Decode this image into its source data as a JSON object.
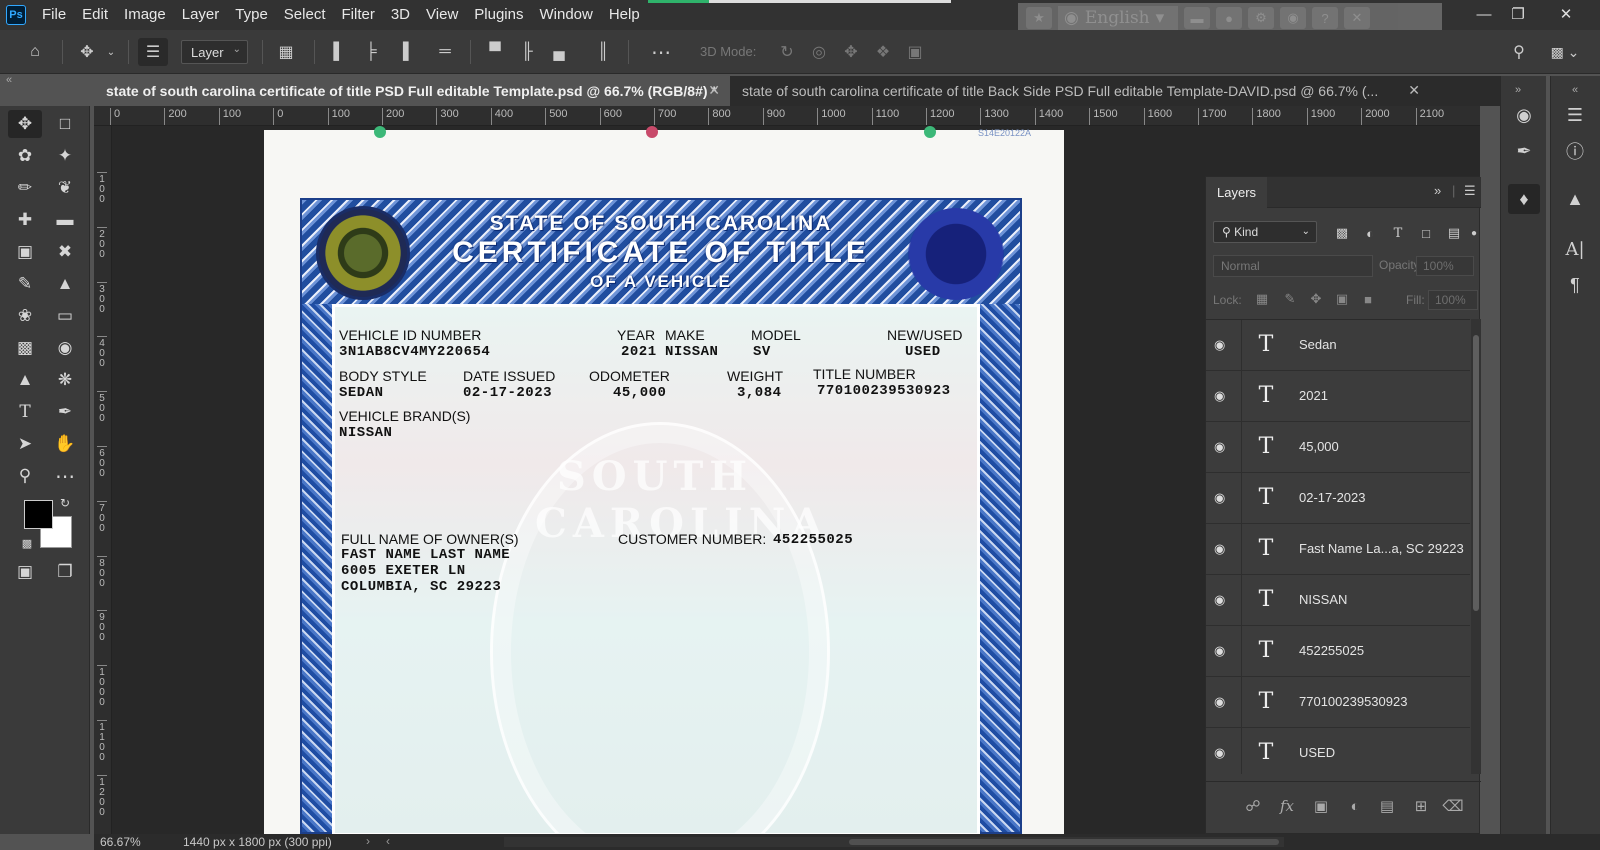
{
  "app": {
    "logo": "Ps"
  },
  "menu": [
    "File",
    "Edit",
    "Image",
    "Layer",
    "Type",
    "Select",
    "Filter",
    "3D",
    "View",
    "Plugins",
    "Window",
    "Help"
  ],
  "task_progress": 0.2,
  "system_tray": {
    "language": "English"
  },
  "options_bar": {
    "layer_select_value": "Layer",
    "mode_3d_label": "3D Mode:"
  },
  "tabs": [
    {
      "label": "state of south carolina certificate of title PSD Full editable Template.psd @ 66.7% (RGB/8#) *",
      "active": true
    },
    {
      "label": "state of south carolina certificate of title Back Side PSD Full editable Template-DAVID.psd @ 66.7% (...",
      "active": false
    }
  ],
  "rulers": {
    "horizontal": [
      "0",
      "200",
      "100",
      "0",
      "100",
      "200",
      "300",
      "400",
      "500",
      "600",
      "700",
      "800",
      "900",
      "1000",
      "1100",
      "1200",
      "1300",
      "1400",
      "1500",
      "1600",
      "1700",
      "1800",
      "1900",
      "2000",
      "2100"
    ],
    "vertical": [
      "100",
      "200",
      "300",
      "400",
      "500",
      "600",
      "700",
      "800",
      "900",
      "1000",
      "1100",
      "1200"
    ]
  },
  "document": {
    "corner_code": "S14E20122A",
    "header": {
      "line1": "STATE OF SOUTH CAROLINA",
      "line2": "CERTIFICATE OF TITLE",
      "line3": "OF A VEHICLE"
    },
    "watermark_text": "SOUTH CAROLINA",
    "fields": {
      "vehicle_id_label": "VEHICLE ID NUMBER",
      "vehicle_id_value": "3N1AB8CV4MY220654",
      "year_label": "YEAR",
      "year_value": "2021",
      "make_label": "MAKE",
      "make_value": "NISSAN",
      "model_label": "MODEL",
      "model_value": "SV",
      "new_used_label": "NEW/USED",
      "new_used_value": "USED",
      "body_style_label": "BODY STYLE",
      "body_style_value": "SEDAN",
      "date_issued_label": "DATE ISSUED",
      "date_issued_value": "02-17-2023",
      "odometer_label": "ODOMETER",
      "odometer_value": "45,000",
      "weight_label": "WEIGHT",
      "weight_value": "3,084",
      "title_number_label": "TITLE NUMBER",
      "title_number_value": "770100239530923",
      "brands_label": "VEHICLE BRAND(S)",
      "brands_value": "NISSAN",
      "owner_label": "FULL NAME OF OWNER(S)",
      "owner_name": "FAST NAME LAST NAME",
      "owner_street": "6005 EXETER LN",
      "owner_city": "COLUMBIA, SC 29223",
      "customer_number_label": "CUSTOMER NUMBER:",
      "customer_number_value": "452255025"
    }
  },
  "layers_panel": {
    "title": "Layers",
    "kind_filter": "Kind",
    "blend_mode": "Normal",
    "opacity_label": "Opacity:",
    "opacity_value": "100%",
    "lock_label": "Lock:",
    "fill_label": "Fill:",
    "fill_value": "100%",
    "layers": [
      {
        "name": "Sedan",
        "type_glyph": "T"
      },
      {
        "name": "2021",
        "type_glyph": "T"
      },
      {
        "name": "45,000",
        "type_glyph": "T"
      },
      {
        "name": "02-17-2023",
        "type_glyph": "T"
      },
      {
        "name": "Fast Name La...a, SC 29223",
        "type_glyph": "T"
      },
      {
        "name": "NISSAN",
        "type_glyph": "T"
      },
      {
        "name": "452255025",
        "type_glyph": "T"
      },
      {
        "name": "770100239530923",
        "type_glyph": "T"
      },
      {
        "name": "USED",
        "type_glyph": "T"
      }
    ]
  },
  "status_bar": {
    "zoom": "66.67%",
    "doc_info": "1440 px x 1800 px (300 ppi)"
  },
  "colors": {
    "foreground": "#000000",
    "background": "#ffffff",
    "accent": "#31a8ff"
  }
}
